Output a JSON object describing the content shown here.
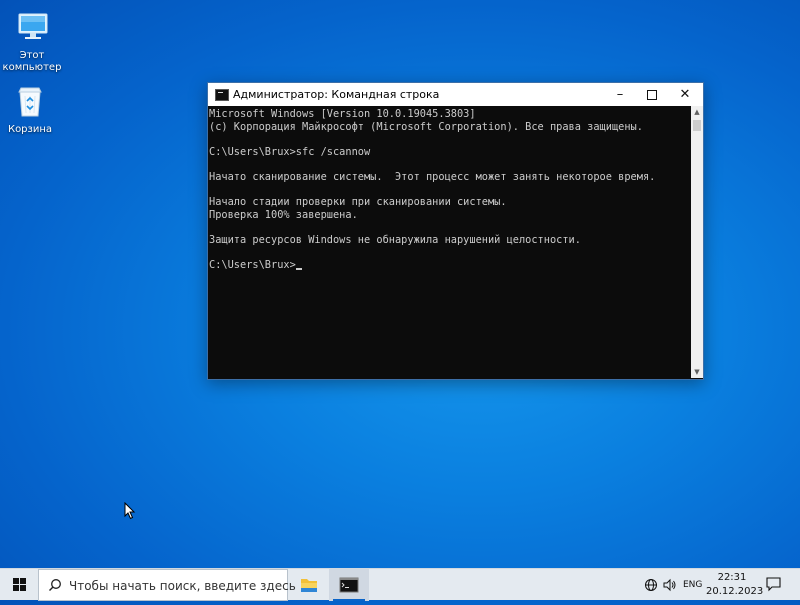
{
  "desktop": {
    "icons": [
      {
        "label": "Этот компьютер",
        "icon": "computer-icon"
      },
      {
        "label": "Корзина",
        "icon": "recycle-bin-icon"
      }
    ]
  },
  "window": {
    "title": "Администратор: Командная строка",
    "controls": {
      "minimize": "–",
      "close": "✕"
    },
    "console_lines": [
      "Microsoft Windows [Version 10.0.19045.3803]",
      "(c) Корпорация Майкрософт (Microsoft Corporation). Все права защищены.",
      "",
      "C:\\Users\\Brux>sfc /scannow",
      "",
      "Начато сканирование системы.  Этот процесс может занять некоторое время.",
      "",
      "Начало стадии проверки при сканировании системы.",
      "Проверка 100% завершена.",
      "",
      "Защита ресурсов Windows не обнаружила нарушений целостности.",
      ""
    ],
    "prompt": "C:\\Users\\Brux>"
  },
  "taskbar": {
    "search_placeholder": "Чтобы начать поиск, введите здесь",
    "language": "ENG",
    "time": "22:31",
    "date": "20.12.2023",
    "accent": "#0a64c8"
  },
  "colors": {
    "desktop_background": "#0a7fdf",
    "console_background": "#0c0c0c",
    "console_text": "#cccccc",
    "taskbar_background": "#e4eaf0"
  }
}
